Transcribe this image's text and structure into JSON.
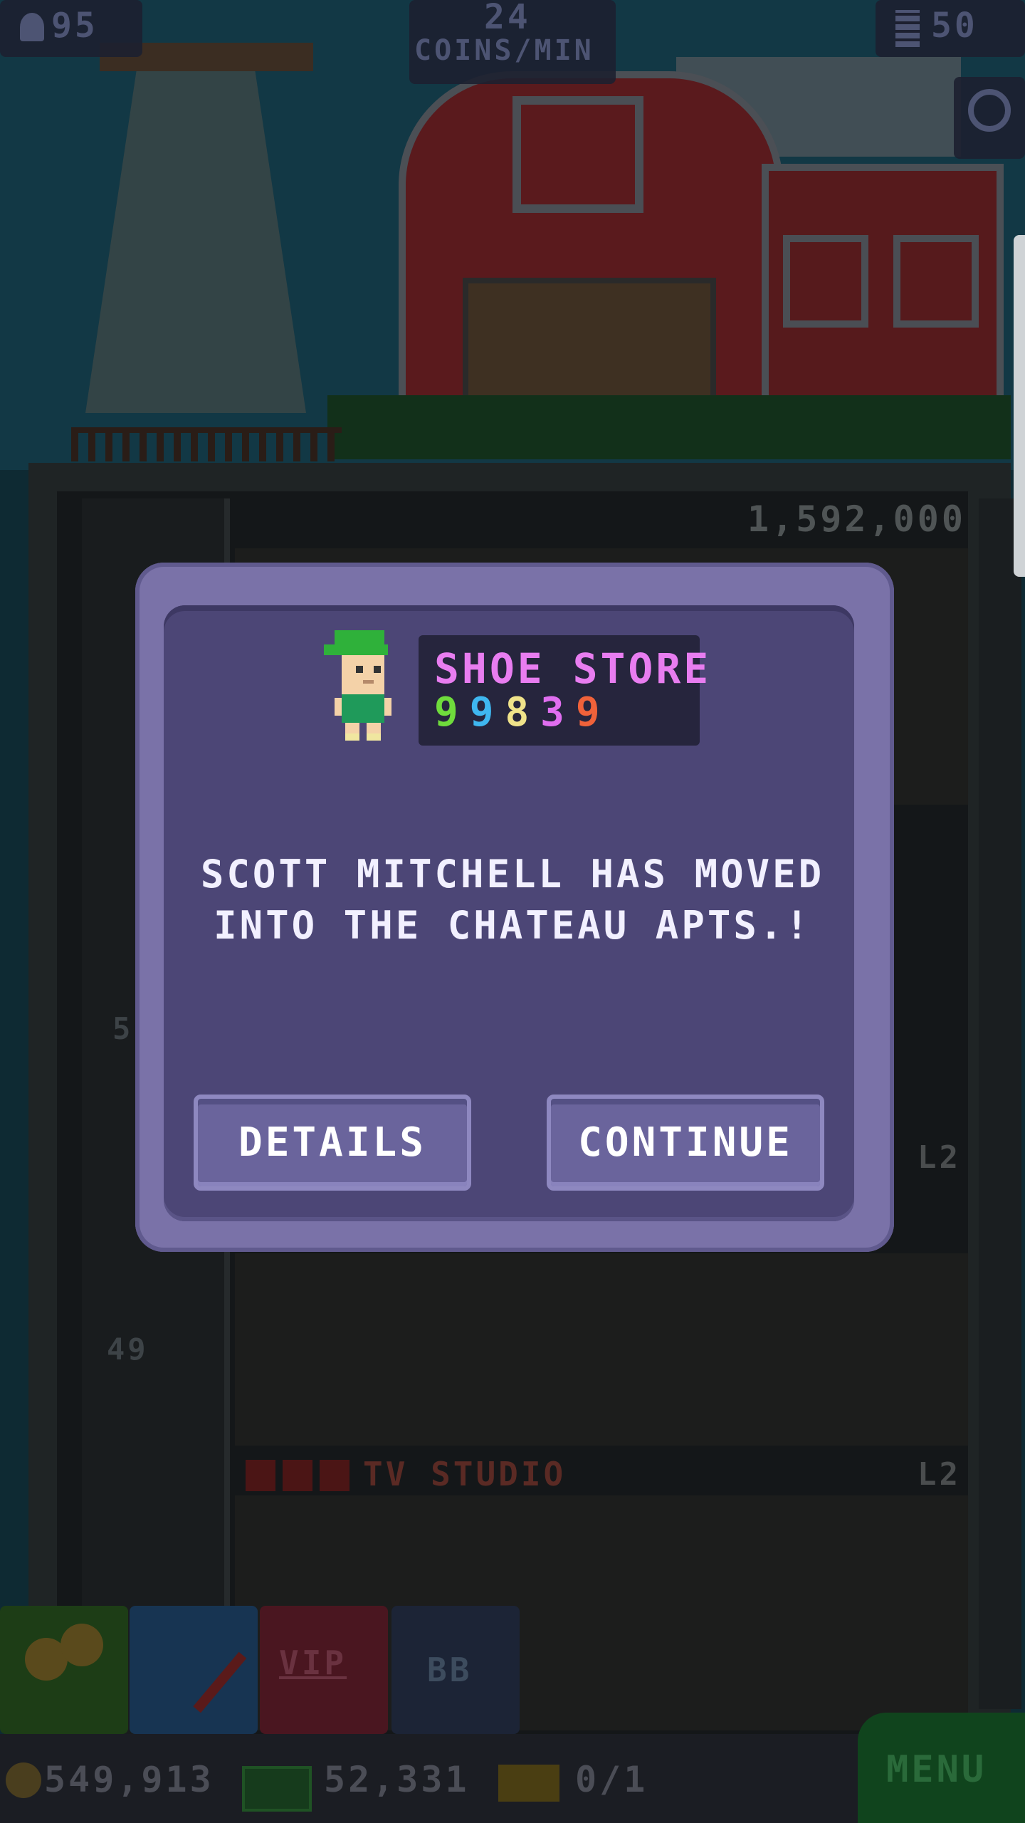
{
  "hud": {
    "population": "95",
    "coins_rate_value": "24",
    "coins_rate_unit": "COINS/MIN",
    "floors": "50"
  },
  "tower": {
    "next_floor_price": "1,592,000",
    "floor_numbers": [
      "5",
      "49"
    ],
    "floor_level_labels": [
      "L2",
      "L2"
    ],
    "tv_studio_label": "TV STUDIO"
  },
  "modal": {
    "store_name": "SHOE STORE",
    "store_digits": [
      {
        "d": "9",
        "color": "#6fdc3c"
      },
      {
        "d": "9",
        "color": "#3fb7f0"
      },
      {
        "d": "8",
        "color": "#f0e38a"
      },
      {
        "d": "3",
        "color": "#e06ef0"
      },
      {
        "d": "9",
        "color": "#f0623a"
      }
    ],
    "message_line1": "SCOTT MITCHELL HAS MOVED",
    "message_line2": "INTO THE CHATEAU APTS.!",
    "details_label": "DETAILS",
    "continue_label": "CONTINUE"
  },
  "toolbar": {
    "vip_label": "VIP",
    "bb_label": "BB",
    "menu_label": "MENU"
  },
  "currency": {
    "coins": "549,913",
    "bux": "52,331",
    "tickets": "0/1"
  },
  "colors": {
    "modal_frame": "#7a72a8",
    "modal_body": "#4c4676",
    "store_name": "#e87df0",
    "menu_green": "#10441d"
  }
}
